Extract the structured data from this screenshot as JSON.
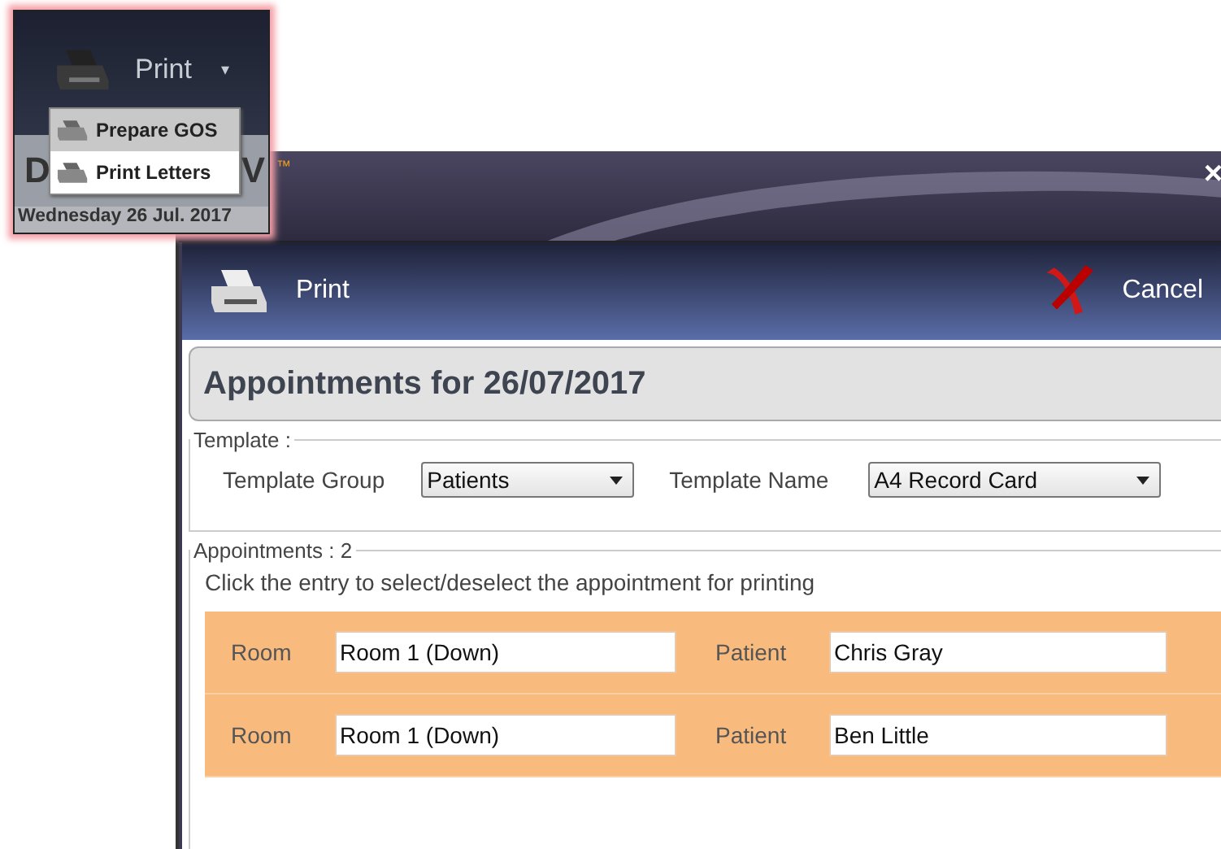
{
  "ribbon": {
    "button": {
      "label": "Print",
      "caret": "▾"
    },
    "menu": [
      {
        "label": "Prepare GOS",
        "selected": false
      },
      {
        "label": "Print Letters",
        "selected": true
      }
    ],
    "behind_left": "D",
    "behind_right": "V",
    "date": "Wednesday 26 Jul. 2017"
  },
  "window": {
    "mark": "™",
    "close": "×"
  },
  "header": {
    "print": "Print",
    "cancel": "Cancel"
  },
  "title": "Appointments for 26/07/2017",
  "template": {
    "legend": "Template :",
    "group_label": "Template Group",
    "group_value": "Patients",
    "name_label": "Template Name",
    "name_value": "A4 Record Card"
  },
  "appointments": {
    "legend": "Appointments : 2",
    "hint": "Click the entry to select/deselect the appointment for printing",
    "rows": [
      {
        "room_label": "Room",
        "room": "Room 1 (Down)",
        "patient_label": "Patient",
        "patient": "Chris Gray",
        "selected": true
      },
      {
        "room_label": "Room",
        "room": "Room 1 (Down)",
        "patient_label": "Patient",
        "patient": "Ben Little",
        "selected": true
      }
    ]
  }
}
